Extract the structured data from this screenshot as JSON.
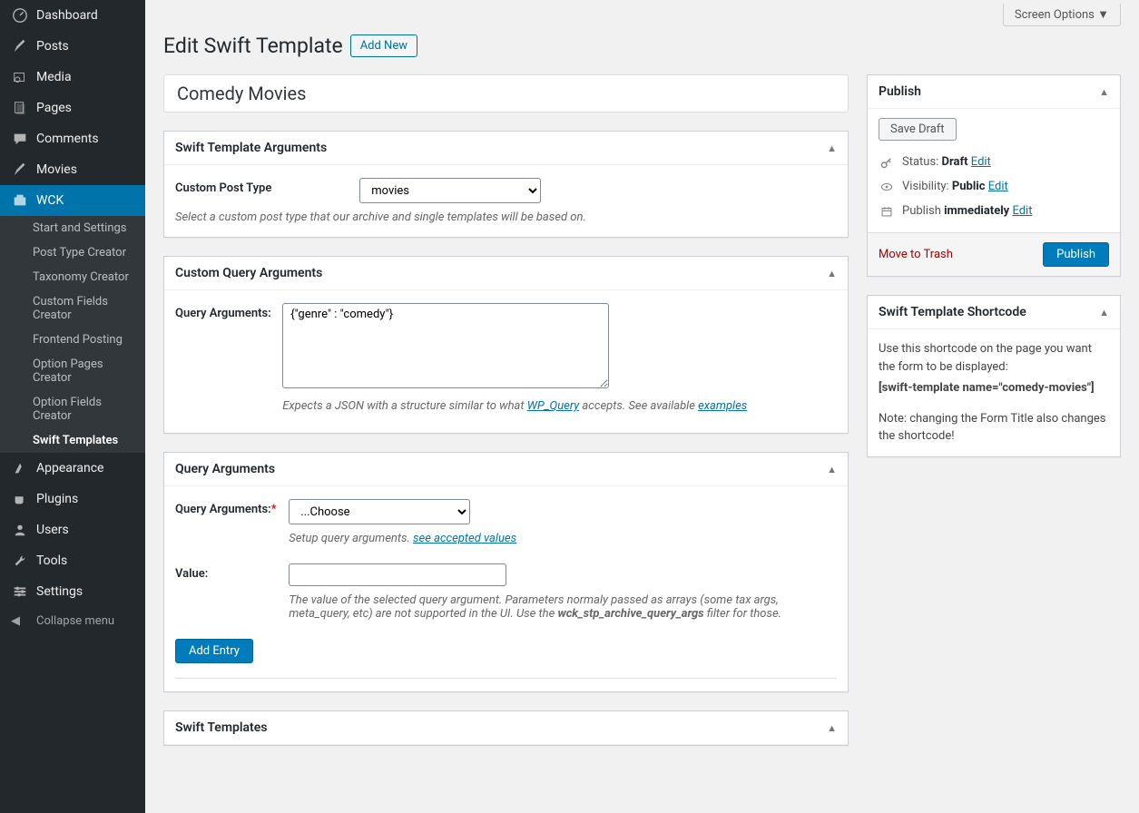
{
  "topbar": {
    "screen_options": "Screen Options"
  },
  "heading": {
    "title": "Edit Swift Template",
    "add_new": "Add New"
  },
  "post_title": "Comedy Movies",
  "menu": {
    "dashboard": "Dashboard",
    "posts": "Posts",
    "media": "Media",
    "pages": "Pages",
    "comments": "Comments",
    "movies": "Movies",
    "wck": "WCK",
    "appearance": "Appearance",
    "plugins": "Plugins",
    "users": "Users",
    "tools": "Tools",
    "settings": "Settings",
    "collapse": "Collapse menu"
  },
  "submenu": {
    "start": "Start and Settings",
    "ptc": "Post Type Creator",
    "tc": "Taxonomy Creator",
    "cfc": "Custom Fields Creator",
    "fp": "Frontend Posting",
    "opc": "Option Pages Creator",
    "ofc": "Option Fields Creator",
    "st": "Swift Templates"
  },
  "box_args": {
    "title": "Swift Template Arguments",
    "field_label": "Custom Post Type",
    "select_value": "movies",
    "desc": "Select a custom post type that our archive and single templates will be based on."
  },
  "box_custom": {
    "title": "Custom Query Arguments",
    "field_label": "Query Arguments:",
    "textarea_value": "{\"genre\" : \"comedy\"}",
    "desc_pre": "Expects a JSON with a structure similar to what ",
    "link1": "WP_Query",
    "desc_mid": " accepts. See available ",
    "link2": "examples"
  },
  "box_query": {
    "title": "Query Arguments",
    "field_label": "Query Arguments:",
    "select_placeholder": "...Choose",
    "desc1_pre": "Setup query arguments. ",
    "desc1_link": "see accepted values",
    "value_label": "Value:",
    "desc2_pre": "The value of the selected query argument. Parameters normaly passed as arrays (some tax args, meta_query, etc) are not supported in the UI. Use the ",
    "desc2_filter": "wck_stp_archive_query_args",
    "desc2_post": " filter for those.",
    "add_entry": "Add Entry"
  },
  "box_templates": {
    "title": "Swift Templates"
  },
  "publish": {
    "title": "Publish",
    "save_draft": "Save Draft",
    "status_label": "Status: ",
    "status_value": "Draft",
    "visibility_label": "Visibility: ",
    "visibility_value": "Public",
    "publish_label_pre": "Publish ",
    "publish_value": "immediately",
    "edit": "Edit",
    "trash": "Move to Trash",
    "publish_btn": "Publish"
  },
  "shortcode_box": {
    "title": "Swift Template Shortcode",
    "text1": "Use this shortcode on the page you want the form to be displayed:",
    "code": "[swift-template name=\"comedy-movies\"]",
    "text2": "Note: changing the Form Title also changes the shortcode!"
  }
}
